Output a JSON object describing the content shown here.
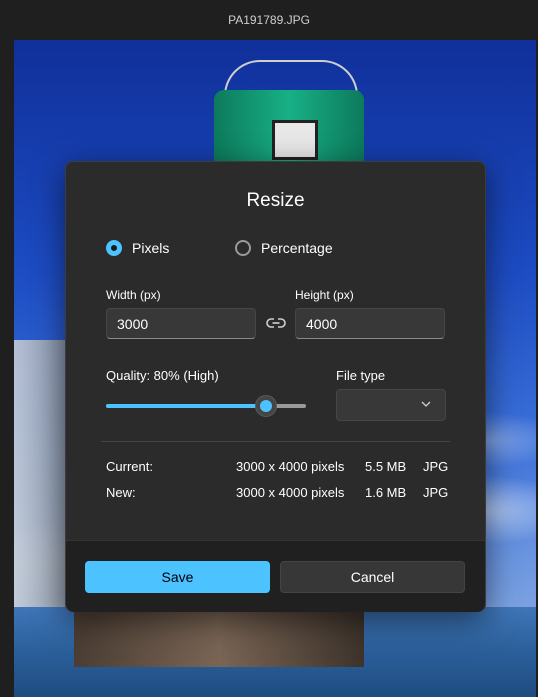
{
  "window": {
    "title": "PA191789.JPG"
  },
  "dialog": {
    "title": "Resize",
    "mode_options": [
      {
        "label": "Pixels",
        "selected": true
      },
      {
        "label": "Percentage",
        "selected": false
      }
    ],
    "width": {
      "label": "Width  (px)",
      "value": "3000"
    },
    "height": {
      "label": "Height  (px)",
      "value": "4000"
    },
    "quality": {
      "label": "Quality: 80% (High)",
      "level": 0.8
    },
    "file_type": {
      "label": "File type",
      "value": ""
    },
    "current": {
      "label": "Current:",
      "dimensions": "3000 x 4000 pixels",
      "size": "5.5 MB",
      "format": "JPG"
    },
    "new": {
      "label": "New:",
      "dimensions": "3000 x 4000 pixels",
      "size": "1.6 MB",
      "format": "JPG"
    },
    "save_label": "Save",
    "cancel_label": "Cancel"
  },
  "colors": {
    "accent": "#4cc2ff",
    "dialog_bg": "#2b2b2b",
    "footer_bg": "#202020"
  },
  "icons": {
    "link": "link-icon",
    "dropdown": "chevron-down-icon"
  }
}
